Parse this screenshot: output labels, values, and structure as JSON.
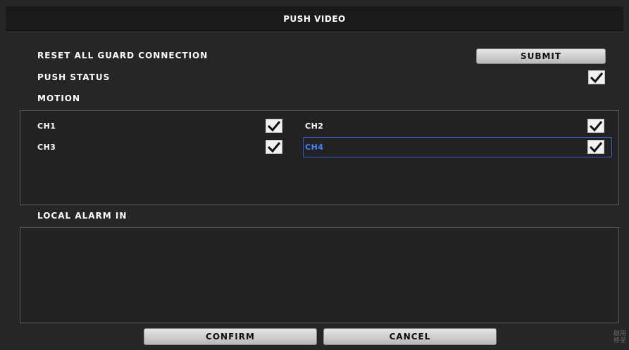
{
  "dialog": {
    "title": "PUSH VIDEO"
  },
  "settings": {
    "reset_label": "RESET ALL GUARD CONNECTION",
    "submit_label": "SUBMIT",
    "push_status_label": "PUSH STATUS",
    "push_status_checked": true,
    "motion_label": "MOTION",
    "local_alarm_label": "LOCAL ALARM IN"
  },
  "motion_channels": [
    {
      "label": "CH1",
      "checked": true,
      "focused": false
    },
    {
      "label": "CH2",
      "checked": true,
      "focused": false
    },
    {
      "label": "CH3",
      "checked": true,
      "focused": false
    },
    {
      "label": "CH4",
      "checked": true,
      "focused": true
    }
  ],
  "local_alarm_channels": [],
  "footer": {
    "confirm_label": "CONFIRM",
    "cancel_label": "CANCEL"
  },
  "watermark": {
    "line1": "啟用",
    "line2": "移至"
  },
  "colors": {
    "background": "#262626",
    "title_bar": "#1a1a1a",
    "focus_text": "#3f86ff",
    "focus_border": "#3a5fd0",
    "button_face": "#d0d0d0"
  },
  "icons": {
    "checkbox": "checkmark-icon"
  }
}
